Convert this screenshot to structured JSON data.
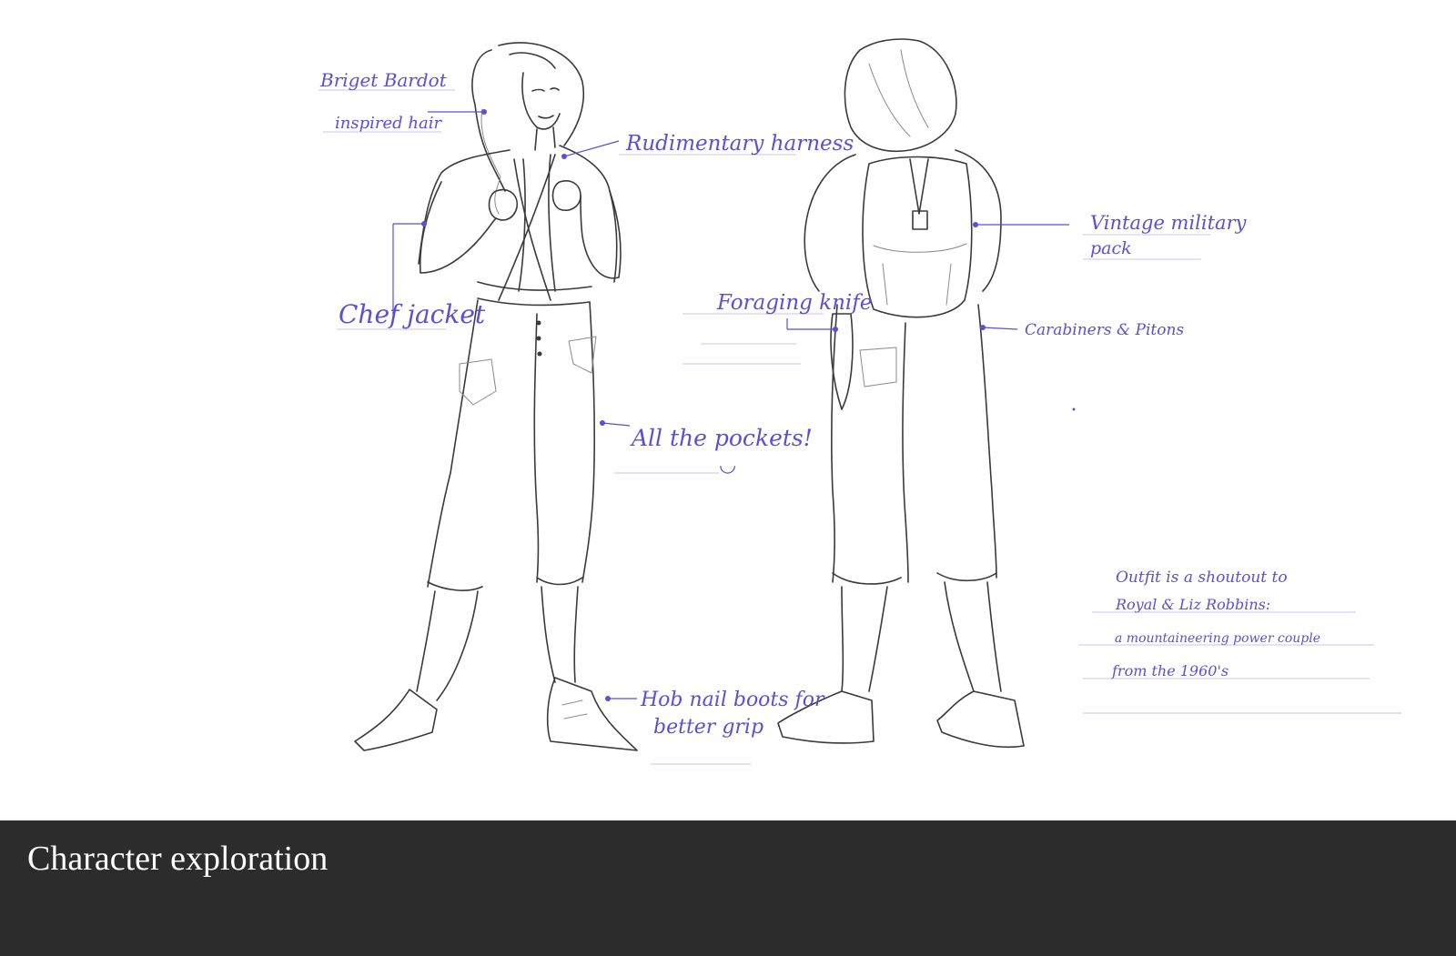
{
  "caption": "Character exploration",
  "annotations": {
    "hair": [
      "Briget Bardot",
      "inspired hair"
    ],
    "harness": "Rudimentary harness",
    "jacket": "Chef jacket",
    "pockets": "All the pockets!",
    "smiley": "◡",
    "boots": [
      "Hob nail boots for",
      "better grip"
    ],
    "knife": "Foraging knife",
    "pack": [
      "Vintage military",
      "pack"
    ],
    "carabiners": "Carabiners & Pitons",
    "shoutout": [
      "Outfit is a shoutout to",
      "Royal & Liz Robbins:",
      "a mountaineering power couple",
      "from the 1960's"
    ]
  },
  "colors": {
    "ink": "#5b4fd6",
    "pencil": "#3a3a3a",
    "caption_bar": "#2c2c2c",
    "caption_text": "#ffffff"
  }
}
